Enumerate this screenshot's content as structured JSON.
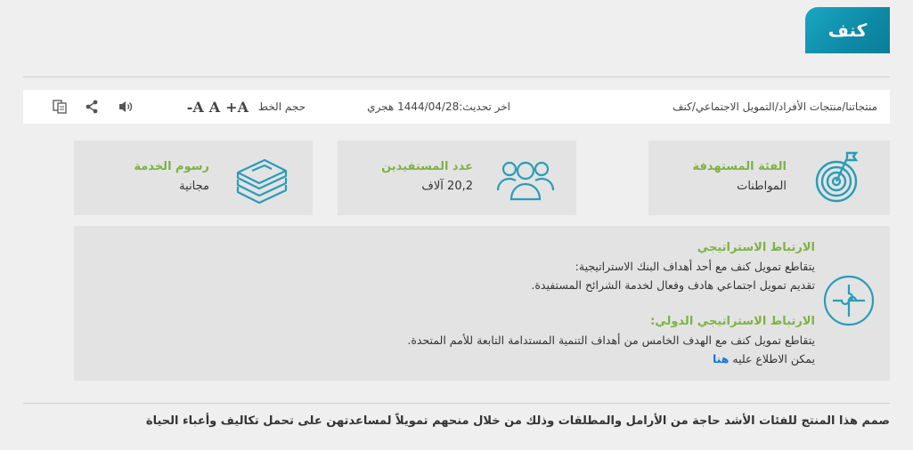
{
  "page_title": "كنف",
  "toolbar": {
    "breadcrumb": "منتجاتنا/منتجات الأفراد/التمويل الاجتماعي/كنف",
    "last_update": "اخر تحديث:1444/04/28 هجري",
    "font_size_label": "حجم الخط",
    "font_increase": "+A",
    "font_normal": "A",
    "font_decrease": "-A"
  },
  "cards": [
    {
      "label": "الفئة المستهدفة",
      "value": "المواطنات",
      "icon": "target-icon"
    },
    {
      "label": "عدد المستفيدين",
      "value": "20,2 آلاف",
      "icon": "users-icon"
    },
    {
      "label": "رسوم الخدمة",
      "value": "مجانية",
      "icon": "money-stack-icon"
    }
  ],
  "strategy": {
    "heading": "الارتباط الاستراتيجي",
    "line1": "يتقاطع تمويل كنف مع أحد أهداف البنك الاستراتيجية:",
    "line2": "تقديم تمويل اجتماعي هادف وفعال لخدمة الشرائح المستفيدة.",
    "heading2": "الارتباط الاستراتيجي الدولي:",
    "line3": "يتقاطع تمويل كنف مع الهدف الخامس من أهداف التنمية المستدامة التابعة للأمم المتحدة.",
    "line4_prefix": "يمكن الاطلاع عليه ",
    "line4_link": "هنا"
  },
  "description": "صمم هذا المنتج للفئات الأشد حاجة من الأرامل والمطلقات وذلك من خلال منحهم تمويلاً لمساعدتهن على تحمل تكاليف وأعباء الحياة",
  "colors": {
    "accent": "#0e8aa6",
    "label_green": "#7cb342",
    "link": "#1a73e8"
  }
}
